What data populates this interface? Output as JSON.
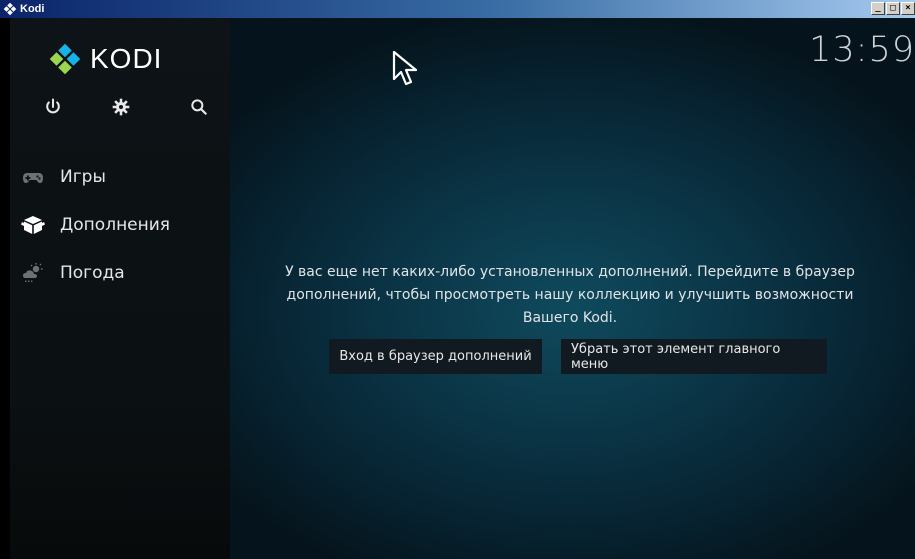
{
  "window": {
    "title": "Kodi"
  },
  "app": {
    "brand": "KODI",
    "clock": "13:59",
    "icons": [
      "power-icon",
      "gear-icon",
      "search-icon"
    ],
    "menu": [
      {
        "label": "Игры",
        "icon": "gamepad-icon"
      },
      {
        "label": "Дополнения",
        "icon": "addons-box-icon"
      },
      {
        "label": "Погода",
        "icon": "weather-icon"
      }
    ],
    "message": "У вас еще нет каких-либо установленных дополнений. Перейдите в браузер дополнений, чтобы просмотреть нашу коллекцию и улучшить возможности Вашего Kodi.",
    "buttons": {
      "browser": "Вход в браузер дополнений",
      "remove": "Убрать этот элемент главного меню"
    },
    "colors": {
      "accent": "#17b2e7",
      "sidebar": "#0d1316",
      "background": "#0a3344"
    }
  }
}
